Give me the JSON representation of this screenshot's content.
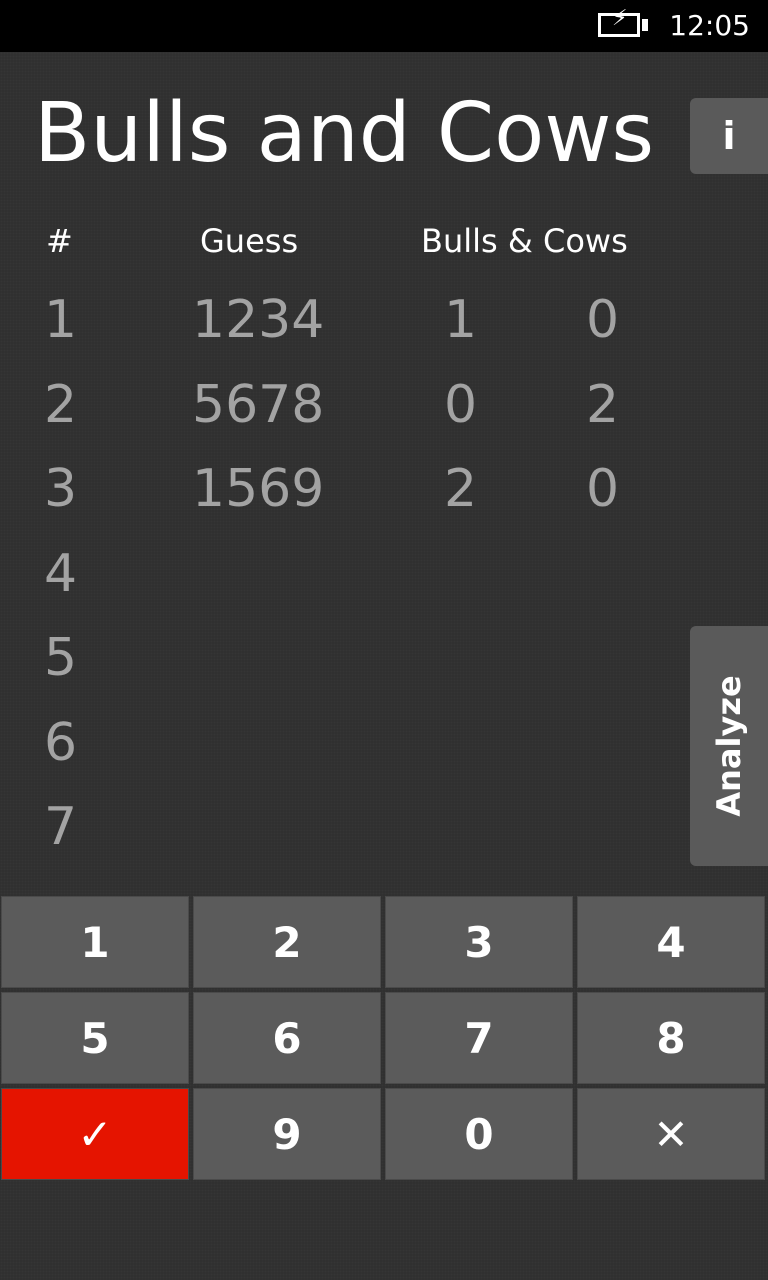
{
  "status_bar": {
    "battery_icon": "battery-charging-icon",
    "time": "12:05"
  },
  "app": {
    "title": "Bulls and Cows",
    "info_button_label": "i",
    "analyze_button_label": "Analyze"
  },
  "table": {
    "headers": {
      "number": "#",
      "guess": "Guess",
      "bulls_cows": "Bulls & Cows"
    },
    "rows": [
      {
        "num": "1",
        "guess": "1234",
        "bulls": "1",
        "cows": "0"
      },
      {
        "num": "2",
        "guess": "5678",
        "bulls": "0",
        "cows": "2"
      },
      {
        "num": "3",
        "guess": "1569",
        "bulls": "2",
        "cows": "0"
      },
      {
        "num": "4",
        "guess": "",
        "bulls": "",
        "cows": ""
      },
      {
        "num": "5",
        "guess": "",
        "bulls": "",
        "cows": ""
      },
      {
        "num": "6",
        "guess": "",
        "bulls": "",
        "cows": ""
      },
      {
        "num": "7",
        "guess": "",
        "bulls": "",
        "cows": ""
      }
    ]
  },
  "keypad": {
    "keys": [
      "1",
      "2",
      "3",
      "4",
      "5",
      "6",
      "7",
      "8",
      "✓",
      "9",
      "0",
      "✕"
    ]
  },
  "colors": {
    "background": "#303030",
    "key": "#5b5b5b",
    "confirm": "#e51400",
    "text_dim": "#a3a3a3"
  }
}
